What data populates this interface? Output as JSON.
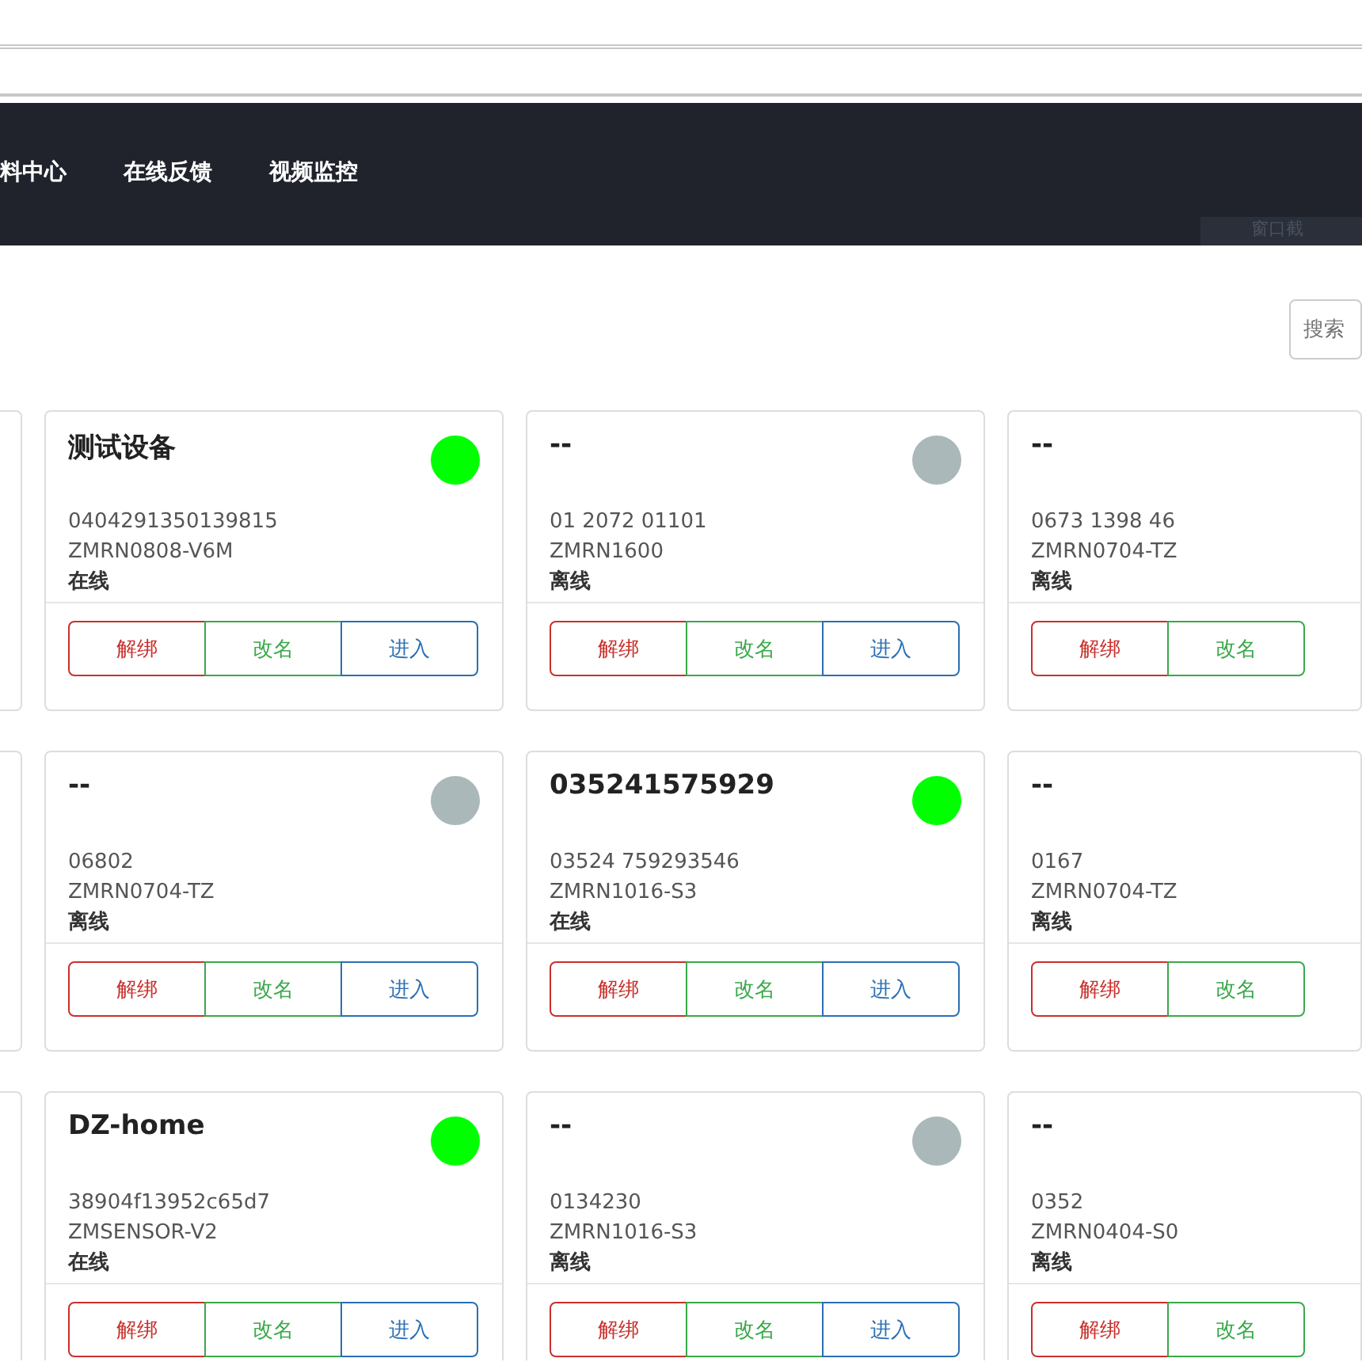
{
  "nav": {
    "items": [
      "料中心",
      "在线反馈",
      "视频监控"
    ],
    "overlay_label": "窗口截"
  },
  "search": {
    "placeholder": "搜索"
  },
  "devices": [
    {
      "name": "测试设备",
      "serial": "0404291350139815",
      "model": "ZMRN0808-V6M",
      "status": "在线",
      "online": true,
      "actions": [
        "解绑",
        "改名",
        "进入"
      ]
    },
    {
      "name": "--",
      "serial": "01 2072 01101",
      "model": "ZMRN1600",
      "status": "离线",
      "online": false,
      "actions": [
        "解绑",
        "改名",
        "进入"
      ]
    },
    {
      "name": "--",
      "serial": "0673 1398 46",
      "model": "ZMRN0704-TZ",
      "status": "离线",
      "actions": [
        "解绑",
        "改名"
      ]
    },
    {
      "name": "--",
      "serial": "06802",
      "model": "ZMRN0704-TZ",
      "status": "离线",
      "online": false,
      "actions": [
        "解绑",
        "改名",
        "进入"
      ]
    },
    {
      "name": "035241575929",
      "serial": "03524 759293546",
      "model": "ZMRN1016-S3",
      "status": "在线",
      "online": true,
      "actions": [
        "解绑",
        "改名",
        "进入"
      ]
    },
    {
      "name": "--",
      "serial": "0167",
      "model": "ZMRN0704-TZ",
      "status": "离线",
      "actions": [
        "解绑",
        "改名"
      ]
    },
    {
      "name": "DZ-home",
      "serial": "38904f13952c65d7",
      "model": "ZMSENSOR-V2",
      "status": "在线",
      "online": true,
      "actions": [
        "解绑",
        "改名",
        "进入"
      ]
    },
    {
      "name": "--",
      "serial": "0134230",
      "model": "ZMRN1016-S3",
      "status": "离线",
      "online": false,
      "actions": [
        "解绑",
        "改名",
        "进入"
      ]
    },
    {
      "name": "--",
      "serial": "0352",
      "model": "ZMRN0404-S0",
      "status": "离线",
      "actions": [
        "解绑",
        "改名"
      ]
    }
  ]
}
